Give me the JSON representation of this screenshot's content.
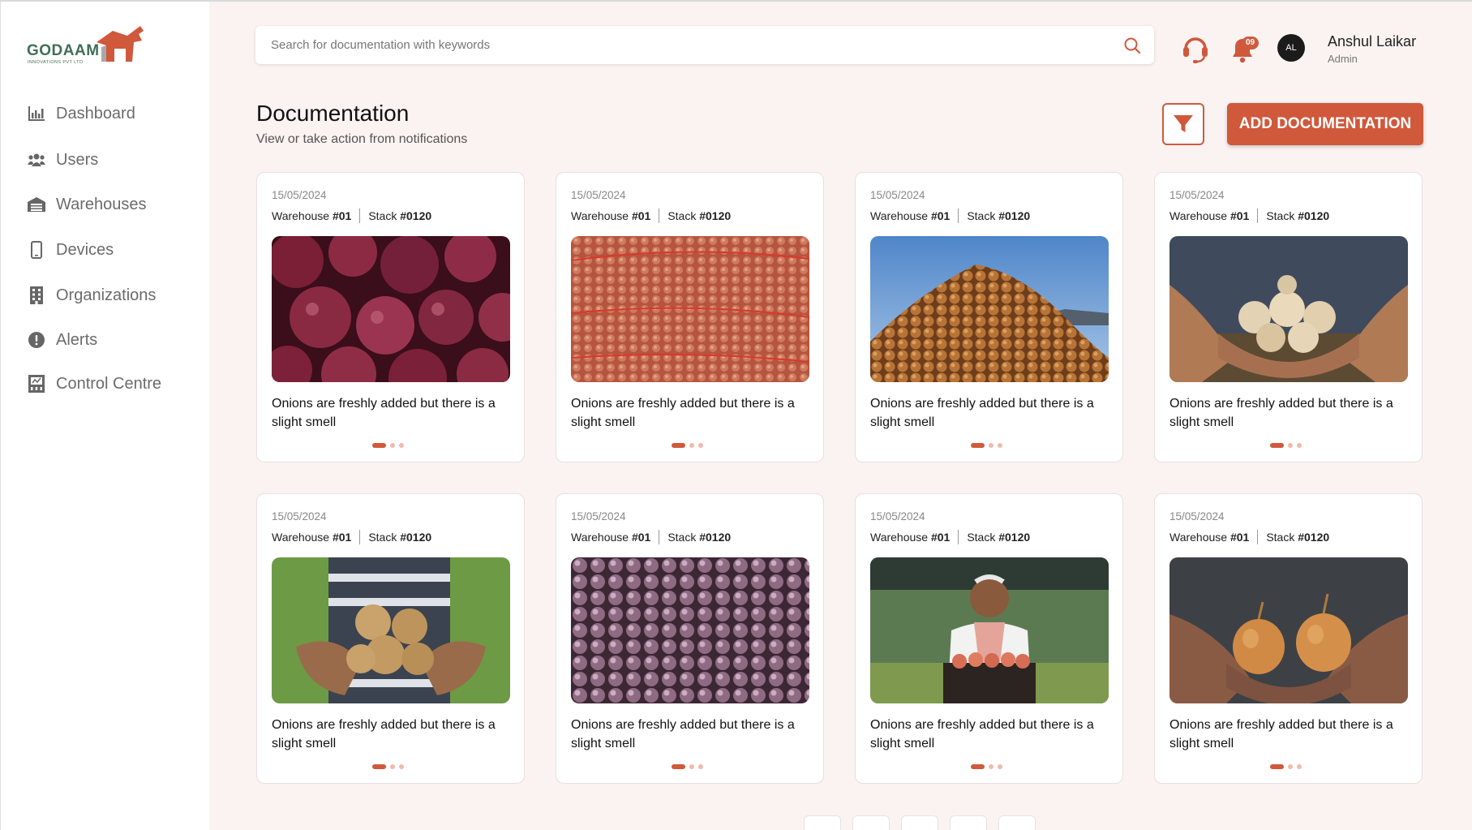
{
  "app": {
    "logo_text": "GODAAM",
    "logo_subtext": "INNOVATIONS PVT LTD"
  },
  "sidebar": {
    "items": [
      {
        "label": "Dashboard",
        "icon": "bar-chart-icon"
      },
      {
        "label": "Users",
        "icon": "users-icon"
      },
      {
        "label": "Warehouses",
        "icon": "warehouse-icon"
      },
      {
        "label": "Devices",
        "icon": "device-icon"
      },
      {
        "label": "Organizations",
        "icon": "building-icon"
      },
      {
        "label": "Alerts",
        "icon": "alert-icon"
      },
      {
        "label": "Control Centre",
        "icon": "control-centre-icon"
      }
    ]
  },
  "header": {
    "search_placeholder": "Search for documentation with keywords",
    "notification_count": "09",
    "avatar_initials": "AL",
    "user_name": "Anshul Laikar",
    "user_role": "Admin"
  },
  "page": {
    "title": "Documentation",
    "subtitle": "View or take action from notifications",
    "add_button_label": "ADD DOCUMENTATION"
  },
  "cards": [
    {
      "date": "15/05/2024",
      "warehouse_label": "Warehouse",
      "warehouse_id": "#01",
      "stack_label": "Stack",
      "stack_id": "#0120",
      "description": "Onions are freshly added but there is a slight smell",
      "image": "red-onions"
    },
    {
      "date": "15/05/2024",
      "warehouse_label": "Warehouse",
      "warehouse_id": "#01",
      "stack_label": "Stack",
      "stack_id": "#0120",
      "description": "Onions are freshly added but there is a slight smell",
      "image": "onion-sacks"
    },
    {
      "date": "15/05/2024",
      "warehouse_label": "Warehouse",
      "warehouse_id": "#01",
      "stack_label": "Stack",
      "stack_id": "#0120",
      "description": "Onions are freshly added but there is a slight smell",
      "image": "onion-pile"
    },
    {
      "date": "15/05/2024",
      "warehouse_label": "Warehouse",
      "warehouse_id": "#01",
      "stack_label": "Stack",
      "stack_id": "#0120",
      "description": "Onions are freshly added but there is a slight smell",
      "image": "onions-in-hands"
    },
    {
      "date": "15/05/2024",
      "warehouse_label": "Warehouse",
      "warehouse_id": "#01",
      "stack_label": "Stack",
      "stack_id": "#0120",
      "description": "Onions are freshly added but there is a slight smell",
      "image": "harvested-onions"
    },
    {
      "date": "15/05/2024",
      "warehouse_label": "Warehouse",
      "warehouse_id": "#01",
      "stack_label": "Stack",
      "stack_id": "#0120",
      "description": "Onions are freshly added but there is a slight smell",
      "image": "purple-shallots"
    },
    {
      "date": "15/05/2024",
      "warehouse_label": "Warehouse",
      "warehouse_id": "#01",
      "stack_label": "Stack",
      "stack_id": "#0120",
      "description": "Onions are freshly added but there is a slight smell",
      "image": "farmer-with-crate"
    },
    {
      "date": "15/05/2024",
      "warehouse_label": "Warehouse",
      "warehouse_id": "#01",
      "stack_label": "Stack",
      "stack_id": "#0120",
      "description": "Onions are freshly added but there is a slight smell",
      "image": "golden-onions-in-hands"
    }
  ],
  "colors": {
    "accent": "#d0583b",
    "background": "#fbf3f1",
    "sidebar": "#ffffff",
    "logo_green": "#3f6f55"
  }
}
